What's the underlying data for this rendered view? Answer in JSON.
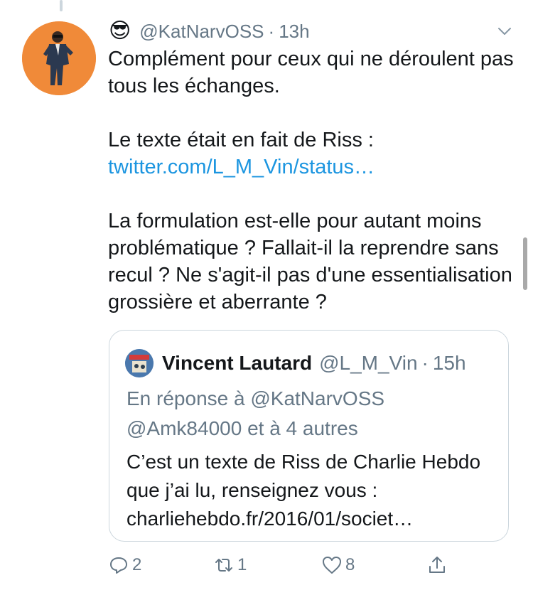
{
  "tweet": {
    "emoji": "😎",
    "handle": "@KatNarvOSS",
    "separator": "·",
    "time": "13h",
    "paragraph1": "Complément pour ceux qui ne déroulent pas tous les échanges.",
    "paragraph2_text": "Le texte était en fait de Riss : ",
    "paragraph2_link": "twitter.com/L_M_Vin/status…",
    "paragraph3": "La formulation est-elle pour autant moins problématique ? Fallait-il la reprendre sans recul ? Ne s'agit-il pas d'une essentialisation grossière et aberrante ?"
  },
  "quoted": {
    "name": "Vincent Lautard",
    "handle": "@L_M_Vin",
    "separator": "·",
    "time": "15h",
    "reply_to": "En réponse à @KatNarvOSS @Amk84000 et à 4 autres",
    "body": "C’est un texte de Riss de Charlie Hebdo que j’ai lu, renseignez vous : charliehebdo.fr/2016/01/societ…"
  },
  "actions": {
    "reply_count": "2",
    "retweet_count": "1",
    "like_count": "8"
  },
  "icons": {
    "menu": "chevron-down-icon",
    "reply": "reply-icon",
    "retweet": "retweet-icon",
    "like": "heart-icon",
    "share": "share-icon"
  },
  "colors": {
    "link": "#1b95e0",
    "secondary": "#657786",
    "avatar_bg": "#f08a39"
  }
}
